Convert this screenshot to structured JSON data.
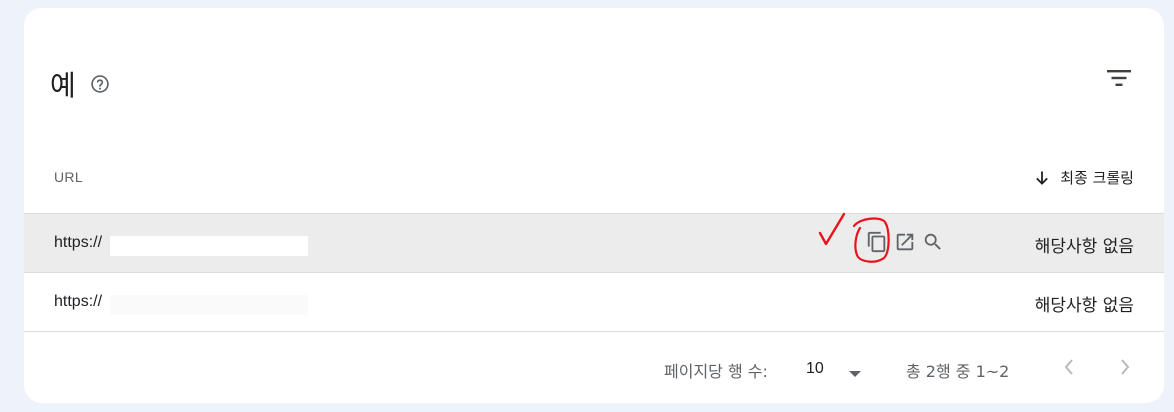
{
  "card": {
    "title": "예",
    "help_icon": "help-circle-icon",
    "filter_icon": "filter-icon"
  },
  "table": {
    "columns": {
      "url": "URL",
      "last_crawl": "최종 크롤링",
      "sort_icon": "arrow-down-icon"
    },
    "rows": [
      {
        "url": "https://",
        "last_crawl": "해당사항 없음",
        "actions": [
          "copy-icon",
          "open-in-new-icon",
          "search-icon"
        ]
      },
      {
        "url": "https://",
        "last_crawl": "해당사항 없음"
      }
    ]
  },
  "annotation": {
    "color": "#e8131b",
    "marks": [
      "checkmark",
      "circle-around-copy-icon"
    ]
  },
  "pagination": {
    "rows_per_page_label": "페이지당 행 수:",
    "rows_per_page_value": "10",
    "range_text": "총 2행 중 1~2",
    "prev_icon": "chevron-left-icon",
    "next_icon": "chevron-right-icon"
  },
  "colors": {
    "page_bg": "#eef2fb",
    "card_bg": "#ffffff",
    "selected_row_bg": "#ececec",
    "icon_gray": "#5f6368"
  }
}
